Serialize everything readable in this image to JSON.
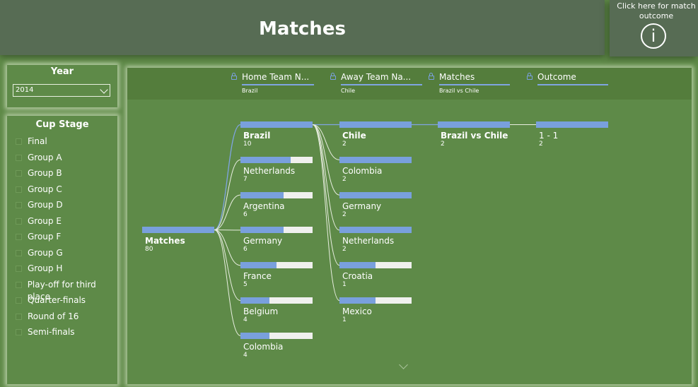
{
  "header": {
    "title": "Matches"
  },
  "info": {
    "text": "Click here for match outcome",
    "icon": "info-circle-icon",
    "glyph": "i"
  },
  "year_filter": {
    "title": "Year",
    "selected": "2014"
  },
  "cup_stage": {
    "title": "Cup Stage",
    "items": [
      "Final",
      "Group A",
      "Group B",
      "Group C",
      "Group D",
      "Group E",
      "Group F",
      "Group G",
      "Group H",
      "Play-off for third place",
      "Quarter-finals",
      "Round of 16",
      "Semi-finals"
    ]
  },
  "decomposition": {
    "columns": [
      {
        "name": "Home Team N...",
        "value": "Brazil"
      },
      {
        "name": "Away Team Na...",
        "value": "Chile"
      },
      {
        "name": "Matches",
        "value": "Brazil vs Chile"
      },
      {
        "name": "Outcome",
        "value": ""
      }
    ],
    "root": {
      "label": "Matches",
      "count": "80"
    },
    "home_teams": [
      {
        "label": "Brazil",
        "count": "10",
        "share": 1.0,
        "selected": true
      },
      {
        "label": "Netherlands",
        "count": "7",
        "share": 0.7
      },
      {
        "label": "Argentina",
        "count": "6",
        "share": 0.6
      },
      {
        "label": "Germany",
        "count": "6",
        "share": 0.6
      },
      {
        "label": "France",
        "count": "5",
        "share": 0.5
      },
      {
        "label": "Belgium",
        "count": "4",
        "share": 0.4
      },
      {
        "label": "Colombia",
        "count": "4",
        "share": 0.4
      }
    ],
    "away_teams": [
      {
        "label": "Chile",
        "count": "2",
        "share": 1.0,
        "selected": true
      },
      {
        "label": "Colombia",
        "count": "2",
        "share": 1.0
      },
      {
        "label": "Germany",
        "count": "2",
        "share": 1.0
      },
      {
        "label": "Netherlands",
        "count": "2",
        "share": 1.0
      },
      {
        "label": "Croatia",
        "count": "1",
        "share": 0.5
      },
      {
        "label": "Mexico",
        "count": "1",
        "share": 0.5
      }
    ],
    "match": {
      "label": "Brazil vs Chile",
      "count": "2",
      "share": 1.0
    },
    "outcome": {
      "label": "1 - 1",
      "count": "2",
      "share": 1.0
    },
    "colors": {
      "bar_fill": "#79a0dd",
      "bar_track": "#f0f0ee",
      "link": "#e8eee0",
      "link_selected": "#7fa4e2"
    }
  }
}
